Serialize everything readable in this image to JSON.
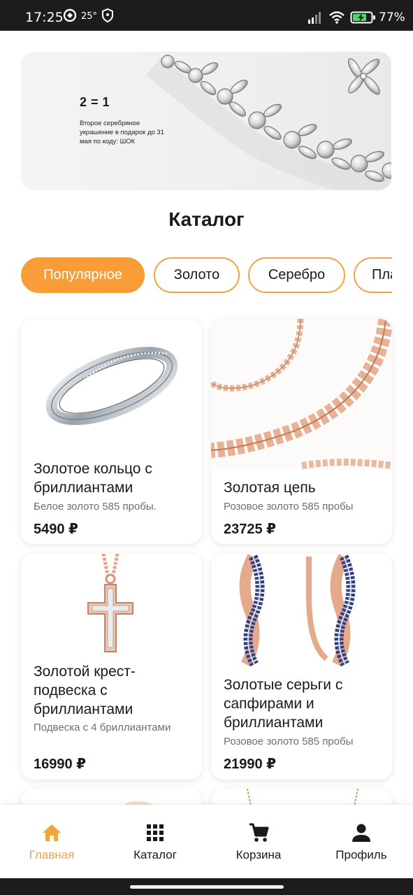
{
  "status_bar": {
    "time": "17:25",
    "temperature": "25°",
    "battery": "77%",
    "icons": [
      "sync-icon",
      "shield-icon",
      "signal-icon",
      "wifi-icon",
      "battery-icon"
    ]
  },
  "banner": {
    "title": "2 = 1",
    "text": "Второе серебряное украшение в подарок до 31 мая по коду: ШОК"
  },
  "page_title": "Каталог",
  "categories": {
    "items": [
      "Популярное",
      "Золото",
      "Серебро",
      "Пла"
    ],
    "active": "Популярное"
  },
  "products": [
    {
      "name": "Золотое кольцо с бриллиантами",
      "description": "Белое золото 585 пробы.",
      "price": "5490 ₽"
    },
    {
      "name": "Золотая цепь",
      "description": "Розовое золото 585 пробы",
      "price": "23725 ₽"
    },
    {
      "name": "Золотой крест-подвеска с бриллиантами",
      "description": "Подвеска с 4 бриллиантами",
      "price": "16990 ₽"
    },
    {
      "name": "Золотые серьги с сапфирами и бриллиантами",
      "description": "Розовое золото 585 пробы",
      "price": "21990 ₽"
    }
  ],
  "bottom_nav": {
    "items": [
      {
        "label": "Главная",
        "icon": "home-icon"
      },
      {
        "label": "Каталог",
        "icon": "grid-icon"
      },
      {
        "label": "Корзина",
        "icon": "cart-icon"
      },
      {
        "label": "Профиль",
        "icon": "person-icon"
      }
    ],
    "active": "Главная"
  },
  "colors": {
    "accent": "#f89d37",
    "status_bar": "#1c1c1c",
    "text": "#1a1a1a",
    "muted_text": "#6e6e6e"
  }
}
